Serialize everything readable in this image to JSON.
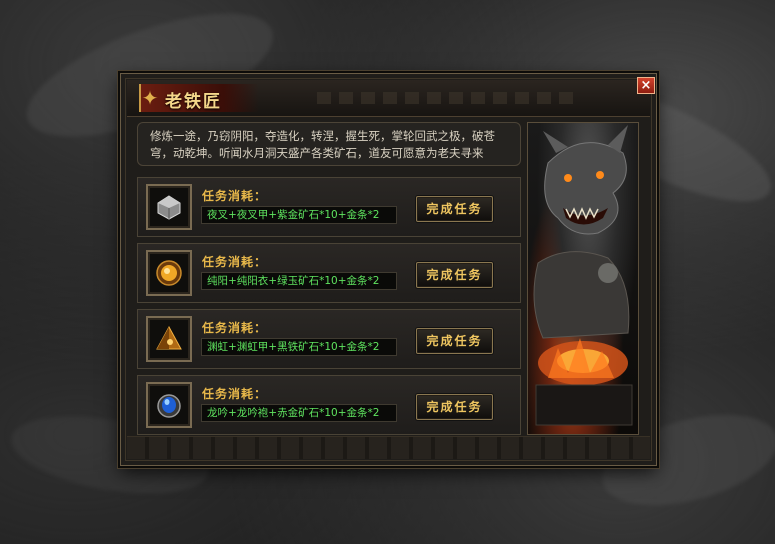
{
  "window": {
    "title": "老铁匠",
    "close_label": "×"
  },
  "intro": {
    "text": "修炼一途，乃窃阴阳，夺造化，转涅，握生死，掌轮回武之极，破苍穹，动乾坤。听闻水月洞天盛产各类矿石，道友可愿意为老夫寻来"
  },
  "tasks": [
    {
      "icon": "silver-cube-icon",
      "label": "任务消耗：",
      "requirement": "夜叉+夜叉甲+紫金矿石*10+金条*2",
      "button": "完成任务"
    },
    {
      "icon": "golden-orb-icon",
      "label": "任务消耗：",
      "requirement": "纯阳+纯阳衣+绿玉矿石*10+金条*2",
      "button": "完成任务"
    },
    {
      "icon": "amber-pyramid-icon",
      "label": "任务消耗：",
      "requirement": "渊虹+渊虹甲+黑铁矿石*10+金条*2",
      "button": "完成任务"
    },
    {
      "icon": "blue-gem-ring-icon",
      "label": "任务消耗：",
      "requirement": "龙吟+龙吟袍+赤金矿石*10+金条*2",
      "button": "完成任务"
    }
  ],
  "colors": {
    "title_gold": "#f4d78a",
    "label_gold": "#e8b84a",
    "requirement_green": "#5fe35f",
    "close_red": "#d4432c"
  },
  "art": "dragon-blacksmith-portrait"
}
